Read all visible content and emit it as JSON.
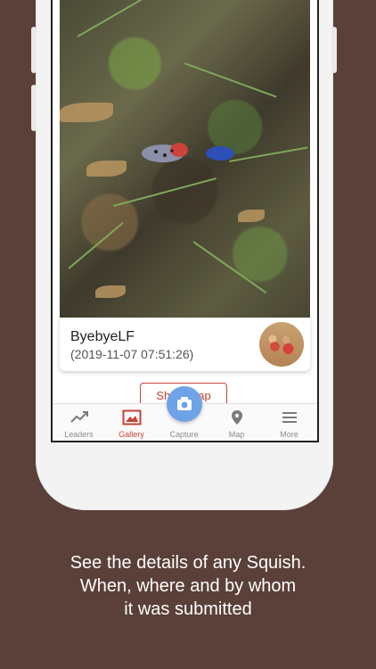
{
  "post": {
    "username": "ByebyeLF",
    "timestamp": "(2019-11-07 07:51:26)"
  },
  "show_map_label": "Show Map",
  "tabs": [
    {
      "label": "Leaders",
      "icon": "trending-up-icon"
    },
    {
      "label": "Gallery",
      "icon": "gallery-icon",
      "active": true
    },
    {
      "label": "Capture",
      "icon": "camera-icon"
    },
    {
      "label": "Map",
      "icon": "map-pin-icon"
    },
    {
      "label": "More",
      "icon": "menu-icon"
    }
  ],
  "caption": {
    "line1": "See the details of any Squish.",
    "line2": "When, where and by whom",
    "line3": "it was submitted"
  },
  "colors": {
    "background": "#5a4039",
    "accent": "#c64336",
    "capture": "#6fa3e8"
  }
}
